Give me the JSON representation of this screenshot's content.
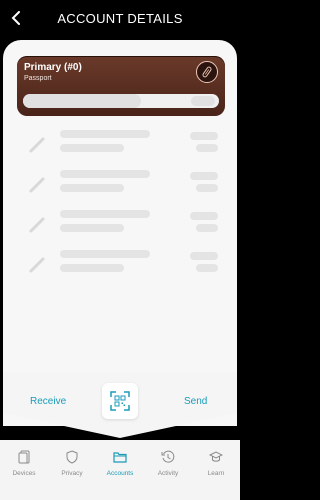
{
  "header": {
    "title": "ACCOUNT DETAILS"
  },
  "account": {
    "name": "Primary (#0)",
    "type": "Passport",
    "bar_fill_fraction": 0.6
  },
  "actions": {
    "receive": "Receive",
    "send": "Send"
  },
  "nav": {
    "items": [
      {
        "label": "Devices"
      },
      {
        "label": "Privacy"
      },
      {
        "label": "Accounts"
      },
      {
        "label": "Activity"
      },
      {
        "label": "Learn"
      }
    ],
    "active_index": 2
  },
  "colors": {
    "accent": "#1a9bb8",
    "card_brown": "#5a2e20"
  }
}
